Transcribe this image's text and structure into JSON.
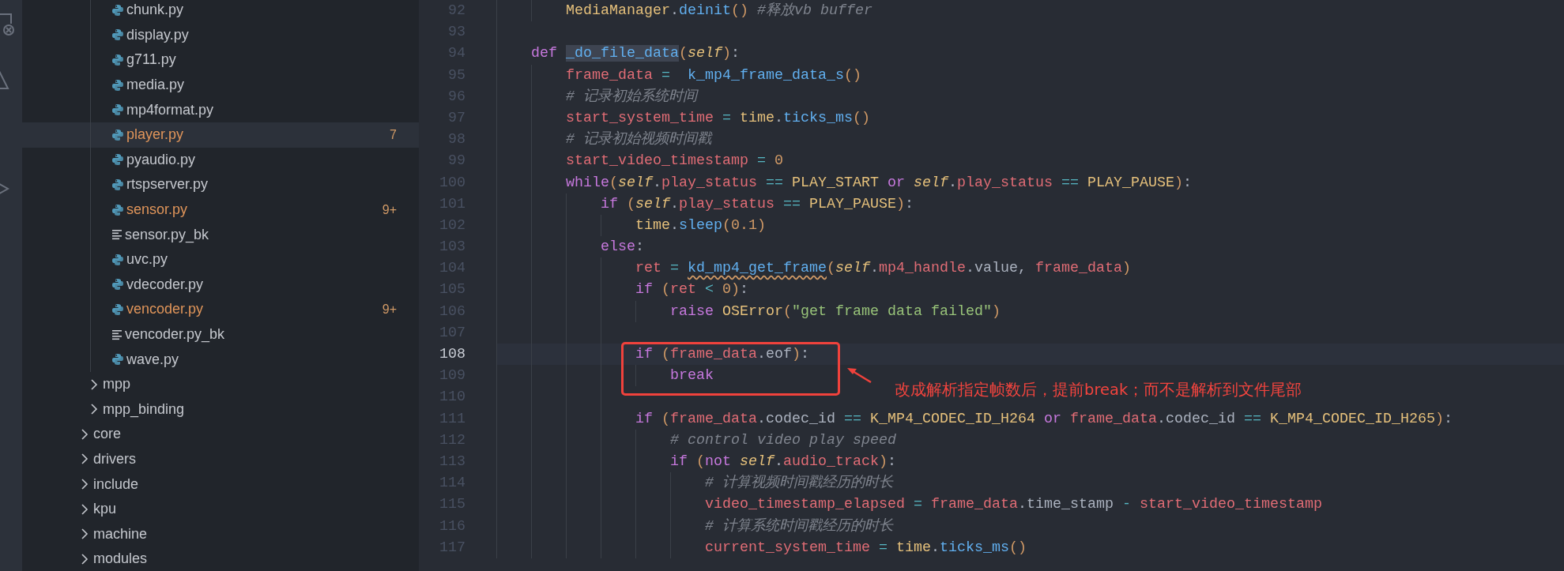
{
  "explorer": {
    "tree": [
      {
        "children": [
          {
            "children": [
              {
                "kind": "python",
                "label": "chunk.py",
                "modified": false,
                "selected": false
              },
              {
                "kind": "python",
                "label": "display.py",
                "modified": false,
                "selected": false
              },
              {
                "kind": "python",
                "label": "g711.py",
                "modified": false,
                "selected": false
              },
              {
                "kind": "python",
                "label": "media.py",
                "modified": false,
                "selected": false
              },
              {
                "kind": "python",
                "label": "mp4format.py",
                "modified": false,
                "selected": false
              },
              {
                "kind": "python",
                "label": "player.py",
                "modified": true,
                "badge": "7",
                "selected": true
              },
              {
                "kind": "python",
                "label": "pyaudio.py",
                "modified": false,
                "selected": false
              },
              {
                "kind": "python",
                "label": "rtspserver.py",
                "modified": false,
                "selected": false
              },
              {
                "kind": "python",
                "label": "sensor.py",
                "modified": true,
                "badge": "9+",
                "selected": false
              },
              {
                "kind": "text",
                "label": "sensor.py_bk",
                "modified": false,
                "selected": false
              },
              {
                "kind": "python",
                "label": "uvc.py",
                "modified": false,
                "selected": false
              },
              {
                "kind": "python",
                "label": "vdecoder.py",
                "modified": false,
                "selected": false
              },
              {
                "kind": "python",
                "label": "vencoder.py",
                "modified": true,
                "badge": "9+",
                "selected": false
              },
              {
                "kind": "text",
                "label": "vencoder.py_bk",
                "modified": false,
                "selected": false
              },
              {
                "kind": "python",
                "label": "wave.py",
                "modified": false,
                "selected": false
              }
            ]
          },
          {
            "kind": "folder",
            "label": "mpp",
            "expanded": false,
            "selected": false
          },
          {
            "kind": "folder",
            "label": "mpp_binding",
            "expanded": false,
            "selected": false
          }
        ]
      },
      {
        "kind": "folder",
        "label": "core",
        "expanded": false,
        "selected": false
      },
      {
        "kind": "folder",
        "label": "drivers",
        "expanded": false,
        "selected": false
      },
      {
        "kind": "folder",
        "label": "include",
        "expanded": false,
        "selected": false
      },
      {
        "kind": "folder",
        "label": "kpu",
        "expanded": false,
        "selected": false
      },
      {
        "kind": "folder",
        "label": "machine",
        "expanded": false,
        "selected": false
      },
      {
        "kind": "folder",
        "label": "modules",
        "expanded": false,
        "selected": false
      }
    ]
  },
  "editor": {
    "lines": [
      {
        "children": [
          {
            "children": [
              {
                "number": "92",
                "selected": false,
                "code": [
                  {
                    "kind": "cls",
                    "text": "MediaManager"
                  },
                  {
                    "kind": "punc",
                    "text": "."
                  },
                  {
                    "kind": "fn",
                    "text": "deinit"
                  },
                  {
                    "kind": "paren",
                    "text": "()"
                  },
                  {
                    "kind": "com",
                    "text": " #释放vb buffer"
                  }
                ]
              }
            ]
          },
          {
            "number": "93",
            "selected": false
          },
          {
            "number": "94",
            "selected": false,
            "code": [
              {
                "kind": "kw",
                "text": "def "
              },
              {
                "kind": "fn",
                "text": "_do_file_data",
                "highlighted": true
              },
              {
                "kind": "paren",
                "text": "("
              },
              {
                "kind": "self",
                "text": "self"
              },
              {
                "kind": "paren",
                "text": ")"
              },
              {
                "kind": "punc",
                "text": ":"
              }
            ],
            "children": [
              {
                "number": "95",
                "selected": false,
                "code": [
                  {
                    "kind": "var",
                    "text": "frame_data"
                  },
                  {
                    "kind": "op",
                    "text": " =  "
                  },
                  {
                    "kind": "fn",
                    "text": "k_mp4_frame_data_s"
                  },
                  {
                    "kind": "paren",
                    "text": "()"
                  }
                ]
              },
              {
                "number": "96",
                "selected": false,
                "code": [
                  {
                    "kind": "com",
                    "text": "# 记录初始系统时间"
                  }
                ]
              },
              {
                "number": "97",
                "selected": false,
                "code": [
                  {
                    "kind": "var",
                    "text": "start_system_time"
                  },
                  {
                    "kind": "op",
                    "text": " = "
                  },
                  {
                    "kind": "cls",
                    "text": "time"
                  },
                  {
                    "kind": "punc",
                    "text": "."
                  },
                  {
                    "kind": "fn",
                    "text": "ticks_ms"
                  },
                  {
                    "kind": "paren",
                    "text": "()"
                  }
                ]
              },
              {
                "number": "98",
                "selected": false,
                "code": [
                  {
                    "kind": "com",
                    "text": "# 记录初始视频时间戳"
                  }
                ]
              },
              {
                "number": "99",
                "selected": false,
                "code": [
                  {
                    "kind": "var",
                    "text": "start_video_timestamp"
                  },
                  {
                    "kind": "op",
                    "text": " = "
                  },
                  {
                    "kind": "num",
                    "text": "0"
                  }
                ]
              },
              {
                "number": "100",
                "selected": false,
                "code": [
                  {
                    "kind": "kw",
                    "text": "while"
                  },
                  {
                    "kind": "paren",
                    "text": "("
                  },
                  {
                    "kind": "self",
                    "text": "self"
                  },
                  {
                    "kind": "punc",
                    "text": "."
                  },
                  {
                    "kind": "var",
                    "text": "play_status"
                  },
                  {
                    "kind": "op",
                    "text": " == "
                  },
                  {
                    "kind": "cls",
                    "text": "PLAY_START"
                  },
                  {
                    "kind": "kw",
                    "text": " or "
                  },
                  {
                    "kind": "self",
                    "text": "self"
                  },
                  {
                    "kind": "punc",
                    "text": "."
                  },
                  {
                    "kind": "var",
                    "text": "play_status"
                  },
                  {
                    "kind": "op",
                    "text": " == "
                  },
                  {
                    "kind": "cls",
                    "text": "PLAY_PAUSE"
                  },
                  {
                    "kind": "paren",
                    "text": ")"
                  },
                  {
                    "kind": "punc",
                    "text": ":"
                  }
                ],
                "children": [
                  {
                    "number": "101",
                    "selected": false,
                    "code": [
                      {
                        "kind": "kw",
                        "text": "if "
                      },
                      {
                        "kind": "paren",
                        "text": "("
                      },
                      {
                        "kind": "self",
                        "text": "self"
                      },
                      {
                        "kind": "punc",
                        "text": "."
                      },
                      {
                        "kind": "var",
                        "text": "play_status"
                      },
                      {
                        "kind": "op",
                        "text": " == "
                      },
                      {
                        "kind": "cls",
                        "text": "PLAY_PAUSE"
                      },
                      {
                        "kind": "paren",
                        "text": ")"
                      },
                      {
                        "kind": "punc",
                        "text": ":"
                      }
                    ],
                    "children": [
                      {
                        "number": "102",
                        "selected": false,
                        "code": [
                          {
                            "kind": "cls",
                            "text": "time"
                          },
                          {
                            "kind": "punc",
                            "text": "."
                          },
                          {
                            "kind": "fn",
                            "text": "sleep"
                          },
                          {
                            "kind": "paren",
                            "text": "("
                          },
                          {
                            "kind": "num",
                            "text": "0.1"
                          },
                          {
                            "kind": "paren",
                            "text": ")"
                          }
                        ]
                      }
                    ]
                  },
                  {
                    "number": "103",
                    "selected": false,
                    "code": [
                      {
                        "kind": "kw",
                        "text": "else"
                      },
                      {
                        "kind": "punc",
                        "text": ":"
                      }
                    ],
                    "children": [
                      {
                        "number": "104",
                        "selected": false,
                        "code": [
                          {
                            "kind": "var",
                            "text": "ret"
                          },
                          {
                            "kind": "op",
                            "text": " = "
                          },
                          {
                            "kind": "fn",
                            "text": "kd_mp4_get_frame",
                            "warning": true
                          },
                          {
                            "kind": "paren",
                            "text": "("
                          },
                          {
                            "kind": "self",
                            "text": "self"
                          },
                          {
                            "kind": "punc",
                            "text": "."
                          },
                          {
                            "kind": "var",
                            "text": "mp4_handle"
                          },
                          {
                            "kind": "plain",
                            "text": ".value, "
                          },
                          {
                            "kind": "var",
                            "text": "frame_data"
                          },
                          {
                            "kind": "paren",
                            "text": ")"
                          }
                        ]
                      },
                      {
                        "number": "105",
                        "selected": false,
                        "code": [
                          {
                            "kind": "kw",
                            "text": "if "
                          },
                          {
                            "kind": "paren",
                            "text": "("
                          },
                          {
                            "kind": "var",
                            "text": "ret"
                          },
                          {
                            "kind": "op",
                            "text": " < "
                          },
                          {
                            "kind": "num",
                            "text": "0"
                          },
                          {
                            "kind": "paren",
                            "text": ")"
                          },
                          {
                            "kind": "punc",
                            "text": ":"
                          }
                        ],
                        "children": [
                          {
                            "number": "106",
                            "selected": false,
                            "code": [
                              {
                                "kind": "kw",
                                "text": "raise "
                              },
                              {
                                "kind": "cls",
                                "text": "OSError"
                              },
                              {
                                "kind": "paren",
                                "text": "("
                              },
                              {
                                "kind": "str",
                                "text": "\"get frame data failed\""
                              },
                              {
                                "kind": "paren",
                                "text": ")"
                              }
                            ]
                          }
                        ]
                      },
                      {
                        "number": "107",
                        "selected": false
                      },
                      {
                        "number": "108",
                        "selected": true,
                        "code": [
                          {
                            "kind": "kw",
                            "text": "if "
                          },
                          {
                            "kind": "paren",
                            "text": "("
                          },
                          {
                            "kind": "var",
                            "text": "frame_data"
                          },
                          {
                            "kind": "plain",
                            "text": ".eof"
                          },
                          {
                            "kind": "paren",
                            "text": ")"
                          },
                          {
                            "kind": "punc",
                            "text": ":"
                          }
                        ],
                        "children": [
                          {
                            "number": "109",
                            "selected": false,
                            "code": [
                              {
                                "kind": "kw",
                                "text": "break"
                              }
                            ]
                          }
                        ]
                      },
                      {
                        "number": "110",
                        "selected": false
                      },
                      {
                        "number": "111",
                        "selected": false,
                        "code": [
                          {
                            "kind": "kw",
                            "text": "if "
                          },
                          {
                            "kind": "paren",
                            "text": "("
                          },
                          {
                            "kind": "var",
                            "text": "frame_data"
                          },
                          {
                            "kind": "plain",
                            "text": ".codec_id "
                          },
                          {
                            "kind": "op",
                            "text": "== "
                          },
                          {
                            "kind": "cls",
                            "text": "K_MP4_CODEC_ID_H264"
                          },
                          {
                            "kind": "kw",
                            "text": " or "
                          },
                          {
                            "kind": "var",
                            "text": "frame_data"
                          },
                          {
                            "kind": "plain",
                            "text": ".codec_id "
                          },
                          {
                            "kind": "op",
                            "text": "== "
                          },
                          {
                            "kind": "cls",
                            "text": "K_MP4_CODEC_ID_H265"
                          },
                          {
                            "kind": "paren",
                            "text": ")"
                          },
                          {
                            "kind": "punc",
                            "text": ":"
                          }
                        ],
                        "children": [
                          {
                            "number": "112",
                            "selected": false,
                            "code": [
                              {
                                "kind": "com",
                                "text": "# control video play speed"
                              }
                            ]
                          },
                          {
                            "number": "113",
                            "selected": false,
                            "code": [
                              {
                                "kind": "kw",
                                "text": "if "
                              },
                              {
                                "kind": "paren",
                                "text": "("
                              },
                              {
                                "kind": "kw",
                                "text": "not "
                              },
                              {
                                "kind": "self",
                                "text": "self"
                              },
                              {
                                "kind": "punc",
                                "text": "."
                              },
                              {
                                "kind": "var",
                                "text": "audio_track"
                              },
                              {
                                "kind": "paren",
                                "text": ")"
                              },
                              {
                                "kind": "punc",
                                "text": ":"
                              }
                            ],
                            "children": [
                              {
                                "number": "114",
                                "selected": false,
                                "code": [
                                  {
                                    "kind": "com",
                                    "text": "# 计算视频时间戳经历的时长"
                                  }
                                ]
                              },
                              {
                                "number": "115",
                                "selected": false,
                                "code": [
                                  {
                                    "kind": "var",
                                    "text": "video_timestamp_elapsed"
                                  },
                                  {
                                    "kind": "op",
                                    "text": " = "
                                  },
                                  {
                                    "kind": "var",
                                    "text": "frame_data"
                                  },
                                  {
                                    "kind": "plain",
                                    "text": ".time_stamp "
                                  },
                                  {
                                    "kind": "op",
                                    "text": "- "
                                  },
                                  {
                                    "kind": "var",
                                    "text": "start_video_timestamp"
                                  }
                                ]
                              },
                              {
                                "number": "116",
                                "selected": false,
                                "code": [
                                  {
                                    "kind": "com",
                                    "text": "# 计算系统时间戳经历的时长"
                                  }
                                ]
                              },
                              {
                                "number": "117",
                                "selected": false,
                                "code": [
                                  {
                                    "kind": "var",
                                    "text": "current_system_time"
                                  },
                                  {
                                    "kind": "op",
                                    "text": " = "
                                  },
                                  {
                                    "kind": "cls",
                                    "text": "time"
                                  },
                                  {
                                    "kind": "punc",
                                    "text": "."
                                  },
                                  {
                                    "kind": "fn",
                                    "text": "ticks_ms"
                                  },
                                  {
                                    "kind": "paren",
                                    "text": "()"
                                  }
                                ]
                              }
                            ]
                          }
                        ]
                      }
                    ]
                  }
                ]
              }
            ]
          }
        ]
      }
    ],
    "annotation": {
      "text": "改成解析指定帧数后，提前break；而不是解析到文件尾部"
    }
  }
}
